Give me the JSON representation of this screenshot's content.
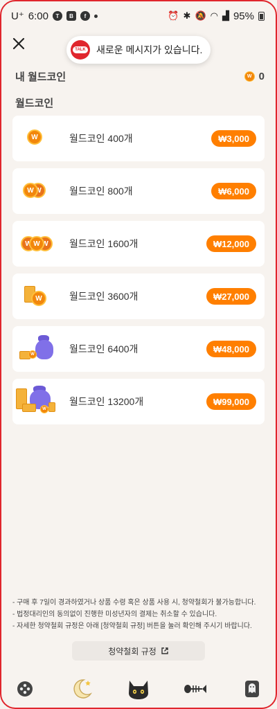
{
  "status_bar": {
    "carrier": "U⁺",
    "time": "6:00",
    "battery": "95%",
    "icons": [
      "talk-icon",
      "b-icon",
      "facebook-icon",
      "alarm-icon",
      "bluetooth-icon",
      "mute-icon",
      "wifi-icon",
      "signal-icon",
      "battery-icon"
    ]
  },
  "toast": {
    "badge": "TALK",
    "text": "새로운 메시지가 있습니다."
  },
  "my_coins": {
    "label": "내 월드코인",
    "value": "0"
  },
  "section_title": "월드코인",
  "coin_symbol": "W",
  "products": [
    {
      "name": "월드코인 400개",
      "price": "₩3,000",
      "icon": "single-coin-icon"
    },
    {
      "name": "월드코인 800개",
      "price": "₩6,000",
      "icon": "double-coin-icon"
    },
    {
      "name": "월드코인 1600개",
      "price": "₩12,000",
      "icon": "triple-coin-icon"
    },
    {
      "name": "월드코인 3600개",
      "price": "₩27,000",
      "icon": "coin-stack-icon"
    },
    {
      "name": "월드코인 6400개",
      "price": "₩48,000",
      "icon": "coin-bag-icon"
    },
    {
      "name": "월드코인 13200개",
      "price": "₩99,000",
      "icon": "treasure-bag-icon"
    }
  ],
  "notes": [
    "- 구매 후 7일이 경과하였거나 상품 수령 혹은 상품 사용 시, 청약철회가 불가능합니다.",
    "- 법정대리인의 동의없이 진행한 미성년자의 결제는 취소할 수 있습니다.",
    "- 자세한 청약철회 규정은 아래 [청약철회 규정] 버튼을 눌러 확인해 주시기 바랍니다."
  ],
  "policy_button": "청약철회 규정",
  "colors": {
    "accent": "#ff7f00",
    "background": "#f7f3ef",
    "card": "#ffffff",
    "frame": "#e0262d"
  },
  "nav": [
    "gamepad-icon",
    "moon-icon",
    "cat-icon",
    "fishbone-icon",
    "ghost-card-icon"
  ]
}
